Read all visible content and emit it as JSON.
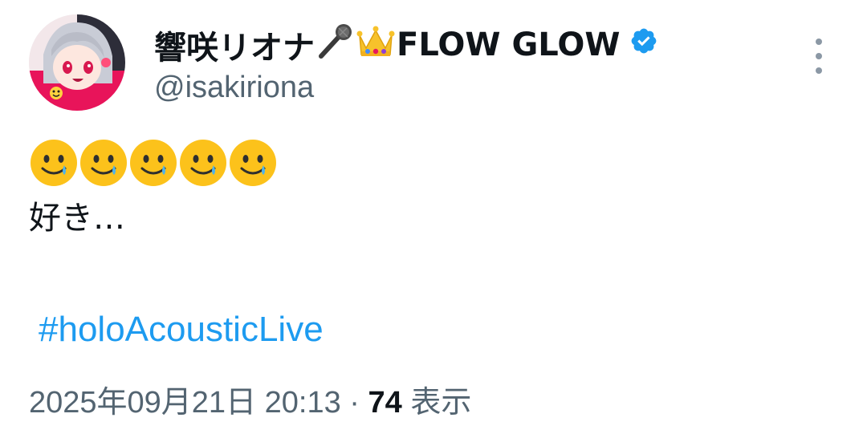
{
  "user": {
    "display_name": "響咲リオナ",
    "name_emojis": [
      "microphone-emoji",
      "crown-emoji"
    ],
    "display_name_suffix": "FLOW GLOW",
    "handle": "@isakiriona",
    "verified": true,
    "avatar_icon": "avatar-illustration"
  },
  "tweet": {
    "emoji_line": [
      "smiling-face-with-tear",
      "smiling-face-with-tear",
      "smiling-face-with-tear",
      "smiling-face-with-tear",
      "smiling-face-with-tear"
    ],
    "text": "好き…",
    "hashtag": "#holoAcousticLive"
  },
  "meta": {
    "timestamp": "2025年09月21日 20:13",
    "separator": " · ",
    "views_count": "74",
    "views_label": " 表示"
  },
  "colors": {
    "text": "#0f1419",
    "secondary": "#536471",
    "link": "#1d9bf0",
    "verified": "#1d9bf0"
  }
}
